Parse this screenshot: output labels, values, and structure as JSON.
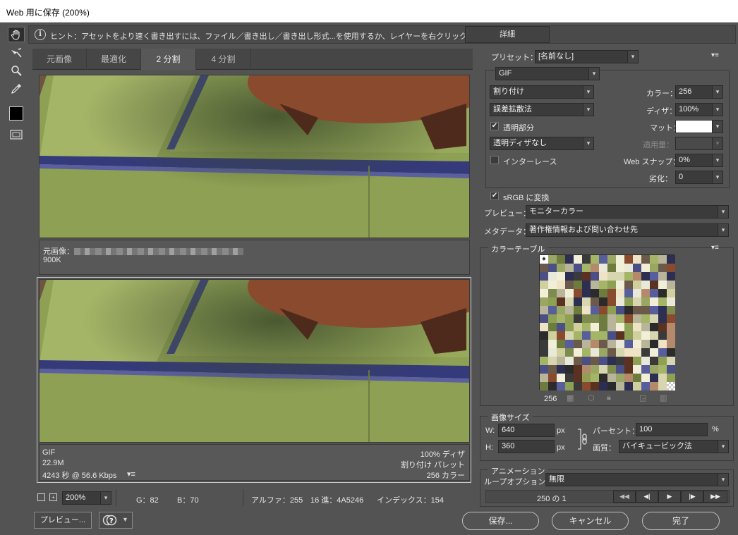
{
  "window": {
    "title": "Web 用に保存 (200%)"
  },
  "hint": {
    "text": "ヒント：アセットをより速く書き出すには、ファイル／書き出し／書き出し形式...を使用するか、レイヤーを右クリックして使用。",
    "detail_button": "詳細"
  },
  "tabs": [
    {
      "label": "元画像",
      "active": false
    },
    {
      "label": "最適化",
      "active": false
    },
    {
      "label": "2 分割",
      "active": true
    },
    {
      "label": "4 分割",
      "active": false
    }
  ],
  "top_pane": {
    "label": "元画像：",
    "size": "900K"
  },
  "bottom_pane": {
    "format": "GIF",
    "size": "22.9M",
    "download_time": "4243 秒 @ 56.6 Kbps",
    "dither": "100% ディザ",
    "palette": "割り付け パレット",
    "colors": "256 カラー"
  },
  "status": {
    "zoom": "200%",
    "g": "G：82",
    "b": "B：70",
    "alpha": "アルファ：255",
    "hex": "16 進：4A5246",
    "index": "インデックス：154"
  },
  "bottom_buttons": {
    "preview": "プレビュー...",
    "save": "保存...",
    "cancel": "キャンセル",
    "done": "完了"
  },
  "settings": {
    "preset_label": "プリセット：",
    "preset_value": "[名前なし]",
    "format": "GIF",
    "reduction": "割り付け",
    "dither_algo": "誤差拡散法",
    "transparency_label": "透明部分",
    "transparency_checked": true,
    "transparency_dither": "透明ディザなし",
    "interlace_label": "インターレース",
    "interlace_checked": false,
    "colors_label": "カラー：",
    "colors_value": "256",
    "dither_label": "ディザ：",
    "dither_value": "100%",
    "matte_label": "マット：",
    "matte_color": "#ffffff",
    "amount_label": "適用量：",
    "websnap_label": "Web スナップ：",
    "websnap_value": "0%",
    "lossy_label": "劣化：",
    "lossy_value": "0",
    "srgb_label": "sRGB に変換",
    "srgb_checked": true,
    "preview_label": "プレビュー：",
    "preview_value": "モニターカラー",
    "metadata_label": "メタデータ：",
    "metadata_value": "著作権情報および問い合わせ先"
  },
  "color_table": {
    "title": "カラーテーブル",
    "count": "256"
  },
  "image_size": {
    "title": "画像サイズ",
    "w_label": "W:",
    "w_value": "640",
    "h_label": "H:",
    "h_value": "360",
    "unit": "px",
    "percent_label": "パーセント：",
    "percent_value": "100",
    "percent_unit": "%",
    "quality_label": "画質：",
    "quality_value": "バイキュービック法"
  },
  "animation": {
    "title": "アニメーション",
    "loop_label": "ループオプション：",
    "loop_value": "無限",
    "frame": "250 の 1"
  }
}
